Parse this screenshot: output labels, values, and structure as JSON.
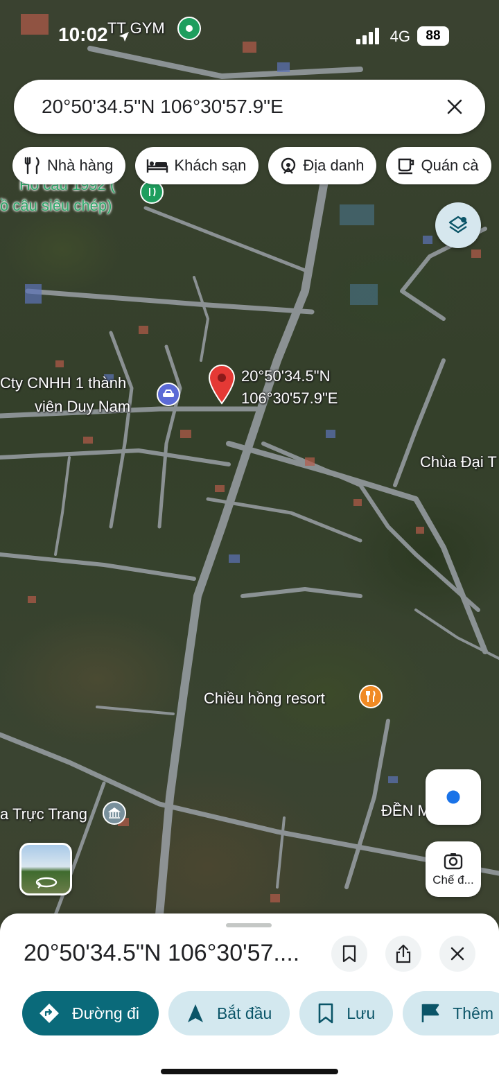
{
  "status_bar": {
    "time": "10:02",
    "carrier": "4G",
    "battery": "88"
  },
  "search": {
    "query": "20°50'34.5\"N 106°30'57.9\"E"
  },
  "chips": [
    {
      "label": "Nhà hàng",
      "icon": "restaurant-icon"
    },
    {
      "label": "Khách sạn",
      "icon": "hotel-icon"
    },
    {
      "label": "Địa danh",
      "icon": "landmark-icon"
    },
    {
      "label": "Quán cà",
      "icon": "coffee-icon"
    }
  ],
  "map": {
    "labels": {
      "gym": "TT GYM",
      "fishing_top": "Hồ câu 1992 (",
      "fishing_bottom": "ồ câu siêu chép)",
      "company_line1": "Cty CNHH 1 thành",
      "company_line2": "viên Duy Nam",
      "pin_line1": "20°50'34.5\"N",
      "pin_line2": "106°30'57.9\"E",
      "pagoda": "Chùa Đại T",
      "resort": "Chiều hồng resort",
      "truc_trang": "a Trực Trang",
      "temple": "ĐỀN M    ỒN"
    }
  },
  "camera_button": {
    "label": "Chế đ..."
  },
  "bottom_sheet": {
    "title": "20°50'34.5\"N 106°30'57....",
    "actions": [
      {
        "label": "Đường đi",
        "icon": "directions-icon"
      },
      {
        "label": "Bắt đầu",
        "icon": "navigation-arrow-icon"
      },
      {
        "label": "Lưu",
        "icon": "bookmark-icon"
      },
      {
        "label": "Thêm",
        "icon": "flag-icon"
      }
    ]
  },
  "colors": {
    "primary": "#0a6a7a",
    "action_bg": "#d3e8ef",
    "pin_red": "#e53935",
    "poi_green": "#1e9e5e",
    "poi_orange": "#f08a24",
    "poi_blue": "#5b6ad6"
  }
}
